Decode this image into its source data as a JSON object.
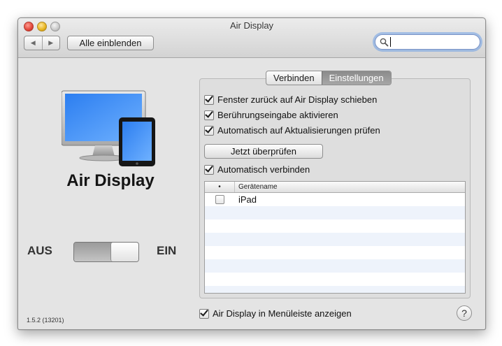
{
  "window": {
    "title": "Air Display"
  },
  "toolbar": {
    "show_all_label": "Alle einblenden",
    "back_arrow": "◀",
    "forward_arrow": "▶",
    "search_value": ""
  },
  "product": {
    "name": "Air Display",
    "version": "1.5.2 (13201)"
  },
  "switch": {
    "off_label": "AUS",
    "on_label": "EIN",
    "state": "on"
  },
  "tabs": [
    {
      "label": "Verbinden",
      "selected": false
    },
    {
      "label": "Einstellungen",
      "selected": true
    }
  ],
  "settings": {
    "options": [
      {
        "label": "Fenster zurück auf Air Display schieben",
        "checked": true
      },
      {
        "label": "Berührungseingabe aktivieren",
        "checked": true
      },
      {
        "label": "Automatisch auf Aktualisierungen prüfen",
        "checked": true
      }
    ],
    "check_now_label": "Jetzt überprüfen",
    "auto_connect_label": "Automatisch verbinden",
    "auto_connect_checked": true
  },
  "devices": {
    "columns": [
      "•",
      "Gerätename"
    ],
    "rows": [
      {
        "name": "iPad",
        "checked": false
      }
    ]
  },
  "footer": {
    "menubar_label": "Air Display in Menüleiste anzeigen",
    "menubar_checked": true,
    "help_label": "?"
  },
  "colors": {
    "screen_blue": "#3f8ef3",
    "search_focus": "#70a0e6"
  }
}
